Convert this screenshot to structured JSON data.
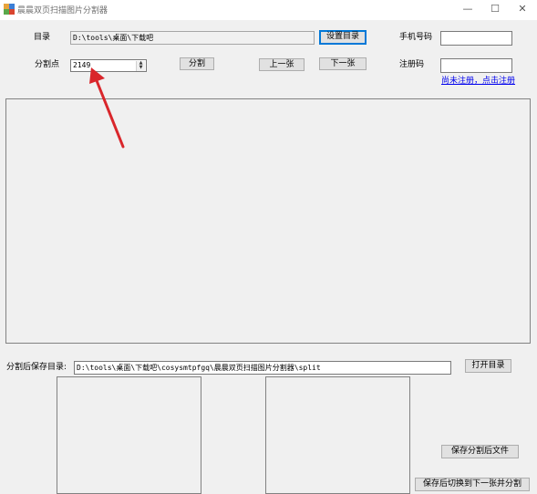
{
  "window": {
    "title": "晨晨双页扫描图片分割器",
    "min_glyph": "—",
    "max_glyph": "☐",
    "close_glyph": "✕"
  },
  "top": {
    "dir_label": "目录",
    "dir_value": "D:\\tools\\桌面\\下载吧",
    "set_dir_button": "设置目录",
    "split_point_label": "分割点",
    "split_point_value": "2149",
    "split_button": "分割",
    "prev_button": "上一张",
    "next_button": "下一张",
    "phone_label": "手机号码",
    "phone_value": "",
    "reg_code_label": "注册码",
    "reg_code_value": "",
    "register_link": "尚未注册，点击注册"
  },
  "bottom": {
    "save_dir_label": "分割后保存目录:",
    "save_dir_value": "D:\\tools\\桌面\\下载吧\\cosysmtpfgq\\晨晨双页扫描图片分割器\\split",
    "open_dir_button": "打开目录",
    "save_split_button": "保存分割后文件",
    "save_next_button": "保存后切换到下一张并分割"
  },
  "colors": {
    "annotation_arrow": "#d9262b",
    "link": "#0000ee",
    "focus": "#0078d7"
  }
}
